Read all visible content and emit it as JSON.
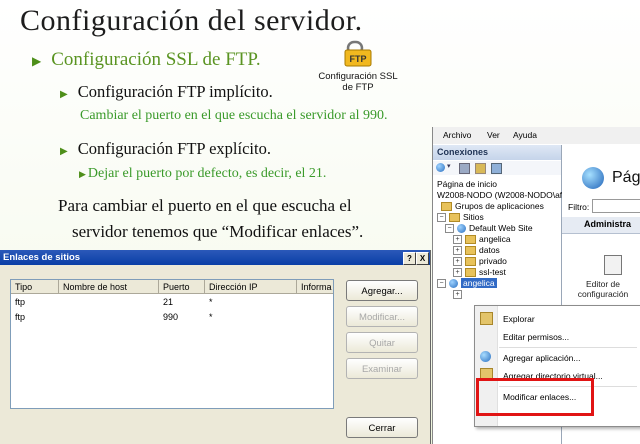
{
  "slide": {
    "title": "Configuración del servidor.",
    "bullet_main": "Configuración SSL de FTP.",
    "ftp_icon_label": "FTP",
    "ftp_caption_line1": "Configuración SSL",
    "ftp_caption_line2": "de FTP",
    "sub1": "Configuración FTP implícito.",
    "sub1_note": "Cambiar el puerto en el que escucha el servidor al 990.",
    "sub2": "Configuración FTP explícito.",
    "sub2_note": "Dejar el puerto por defecto, es decir, el 21.",
    "para_line1": "Para cambiar el puerto en el que escucha el",
    "para_line2": "servidor tenemos que “Modificar enlaces”."
  },
  "iis": {
    "menu": [
      "Archivo",
      "Ver",
      "Ayuda"
    ],
    "connections_header": "Conexiones",
    "tree": [
      "Página de inicio",
      "W2008-NODO (W2008-NODO\\af",
      "Grupos de aplicaciones",
      "Sitios",
      "Default Web Site",
      "angelica",
      "datos",
      "privado",
      "ssl-test",
      "angelica"
    ],
    "right_title": "Pág",
    "filter_label": "Filtro:",
    "admin_header": "Administra",
    "editor_caption_line1": "Editor de",
    "editor_caption_line2": "configuración"
  },
  "context_menu": {
    "items": [
      "Explorar",
      "Editar permisos...",
      "Agregar aplicación...",
      "Agregar directorio virtual...",
      "Modificar enlaces..."
    ]
  },
  "dialog": {
    "title": "Enlaces de sitios",
    "help_button": "?",
    "close_button": "X",
    "columns": [
      "Tipo",
      "Nombre de host",
      "Puerto",
      "Dirección IP",
      "Informa"
    ],
    "rows": [
      {
        "tipo": "ftp",
        "host": "",
        "puerto": "21",
        "ip": "*"
      },
      {
        "tipo": "ftp",
        "host": "",
        "puerto": "990",
        "ip": "*"
      }
    ],
    "buttons": {
      "add": "Agregar...",
      "edit": "Modificar...",
      "remove": "Quitar",
      "browse": "Examinar",
      "close": "Cerrar"
    }
  },
  "colors": {
    "accent_green": "#5a9422",
    "note_green": "#3a9a2a",
    "highlight_red": "#e11414",
    "dialog_title_blue": "#0a3ea6"
  }
}
